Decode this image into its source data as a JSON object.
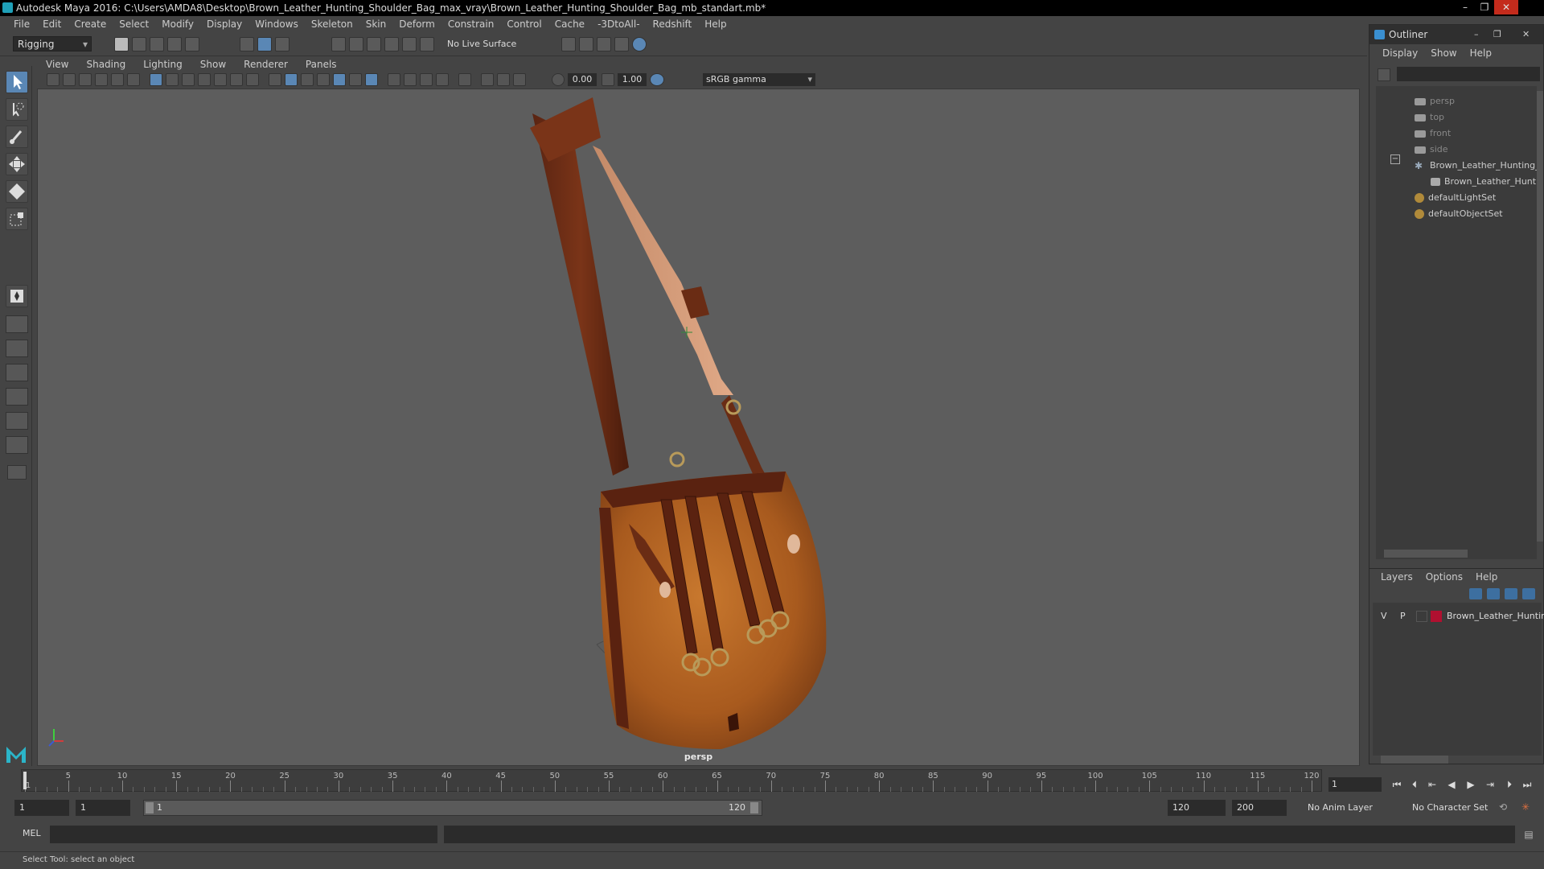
{
  "window": {
    "title": "Autodesk Maya 2016: C:\\Users\\AMDA8\\Desktop\\Brown_Leather_Hunting_Shoulder_Bag_max_vray\\Brown_Leather_Hunting_Shoulder_Bag_mb_standart.mb*"
  },
  "menubar": [
    "File",
    "Edit",
    "Create",
    "Select",
    "Modify",
    "Display",
    "Windows",
    "Skeleton",
    "Skin",
    "Deform",
    "Constrain",
    "Control",
    "Cache",
    "-3DtoAll-",
    "Redshift",
    "Help"
  ],
  "shelf": {
    "mode": "Rigging",
    "live_surface": "No Live Surface"
  },
  "panel": {
    "menu": [
      "View",
      "Shading",
      "Lighting",
      "Show",
      "Renderer",
      "Panels"
    ],
    "exposure": "0.00",
    "gamma": "1.00",
    "color_space": "sRGB gamma",
    "camera_label": "persp"
  },
  "outliner": {
    "title": "Outliner",
    "menu": [
      "Display",
      "Show",
      "Help"
    ],
    "items": [
      {
        "label": "persp",
        "icon": "camera-icon"
      },
      {
        "label": "top",
        "icon": "camera-icon"
      },
      {
        "label": "front",
        "icon": "camera-icon"
      },
      {
        "label": "side",
        "icon": "camera-icon"
      },
      {
        "label": "Brown_Leather_Hunting_",
        "icon": "group-icon"
      },
      {
        "label": "Brown_Leather_Hunti",
        "icon": "mesh-icon"
      },
      {
        "label": "defaultLightSet",
        "icon": "set-icon"
      },
      {
        "label": "defaultObjectSet",
        "icon": "set-icon"
      }
    ]
  },
  "layers": {
    "menu": [
      "Layers",
      "Options",
      "Help"
    ],
    "rows": [
      {
        "visible": "V",
        "playback": "P",
        "name": "Brown_Leather_Huntir",
        "color": "#b01030"
      }
    ]
  },
  "timeline": {
    "ticks": [
      "1",
      "5",
      "10",
      "15",
      "20",
      "25",
      "30",
      "35",
      "40",
      "45",
      "50",
      "55",
      "60",
      "65",
      "70",
      "75",
      "80",
      "85",
      "90",
      "95",
      "100",
      "105",
      "110",
      "115",
      "120"
    ],
    "current_frame": "1"
  },
  "range": {
    "start": "1",
    "playback_start": "1",
    "slider_start": "1",
    "slider_end": "120",
    "playback_end": "120",
    "end": "200",
    "anim_layer": "No Anim Layer",
    "character_set": "No Character Set"
  },
  "command": {
    "language": "MEL"
  },
  "status": {
    "help_line": "Select Tool: select an object"
  }
}
